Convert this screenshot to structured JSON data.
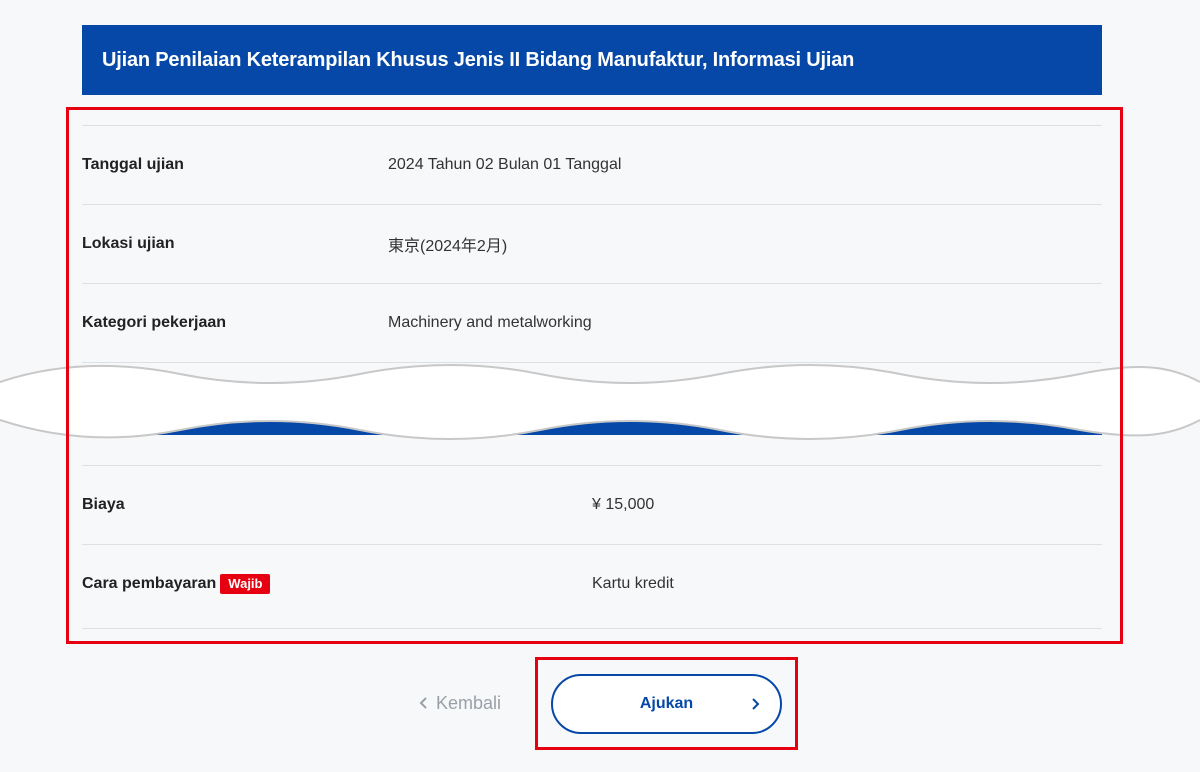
{
  "header": {
    "title": "Ujian Penilaian Keterampilan Khusus Jenis II Bidang Manufaktur, Informasi Ujian"
  },
  "details": {
    "exam_date": {
      "label": "Tanggal ujian",
      "value": "2024 Tahun 02 Bulan 01 Tanggal"
    },
    "exam_location": {
      "label": "Lokasi ujian",
      "value": "東京(2024年2月)"
    },
    "job_category": {
      "label": "Kategori pekerjaan",
      "value": "Machinery and metalworking"
    },
    "fee": {
      "label": "Biaya",
      "value": "¥ 15,000"
    },
    "payment_method": {
      "label": "Cara pembayaran",
      "badge": "Wajib",
      "value": "Kartu kredit"
    }
  },
  "actions": {
    "back_label": "Kembali",
    "submit_label": "Ajukan"
  },
  "colors": {
    "brand_blue": "#0648a8",
    "required_red": "#e60012",
    "highlight_frame": "#e60012"
  },
  "icons": {
    "back": "chevron-left-icon",
    "submit": "chevron-right-icon"
  }
}
